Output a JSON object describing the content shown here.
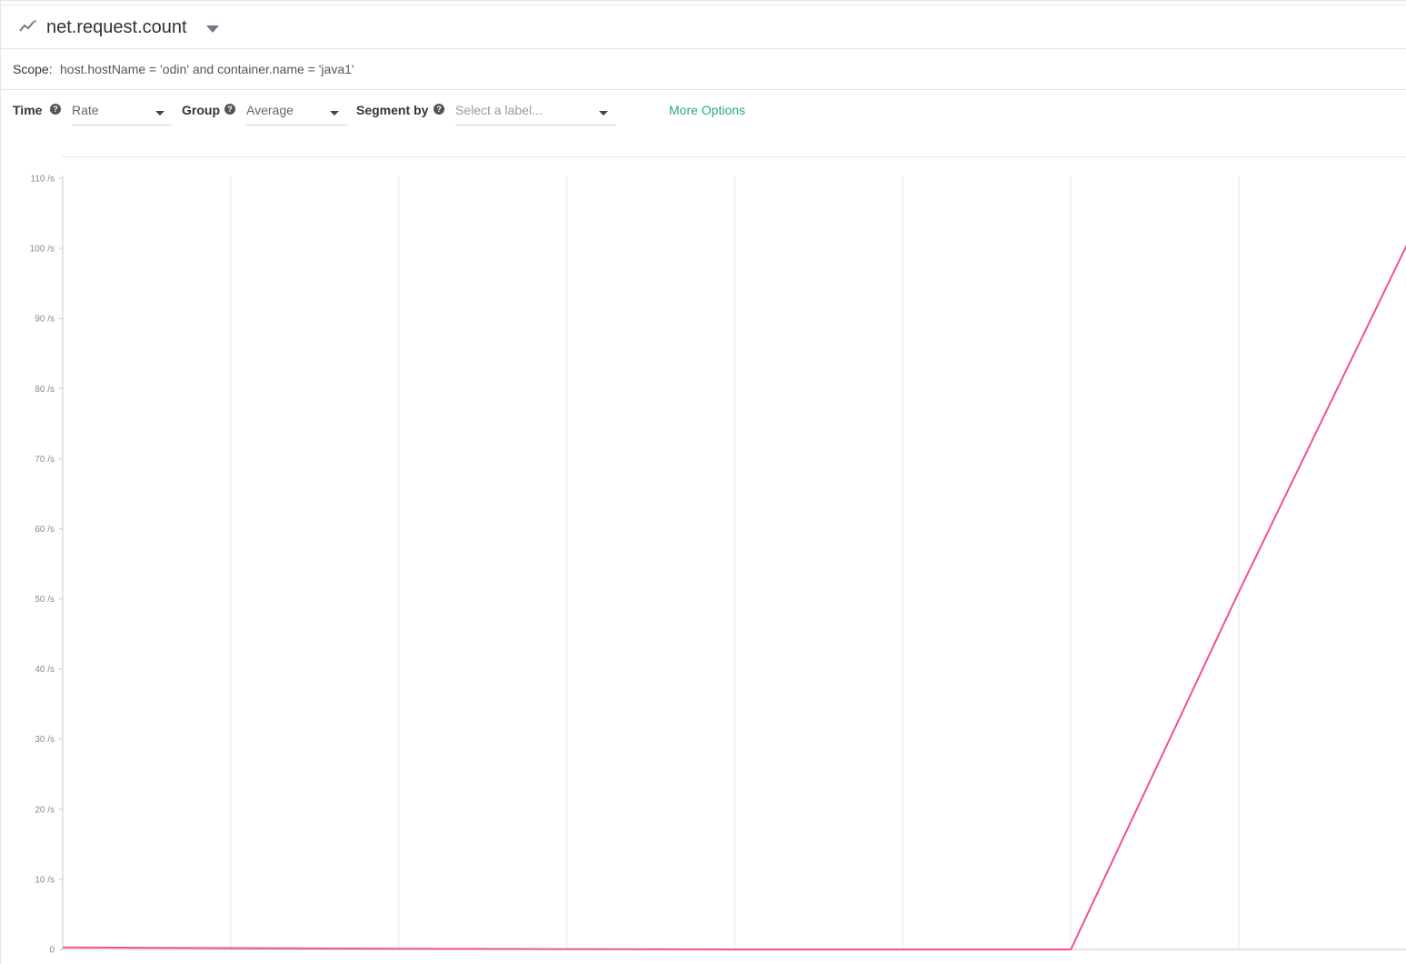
{
  "header": {
    "metric_name": "net.request.count"
  },
  "scope": {
    "label": "Scope:",
    "value": "host.hostName = 'odin' and container.name = 'java1'"
  },
  "controls": {
    "time_label": "Time",
    "time_value": "Rate",
    "group_label": "Group",
    "group_value": "Average",
    "segment_label": "Segment by",
    "segment_placeholder": "Select a label...",
    "more_options": "More Options"
  },
  "colors": {
    "accent": "#2aa886",
    "series": "#f0509a"
  },
  "chart_data": {
    "type": "line",
    "ylim": [
      0,
      110
    ],
    "yticks": [
      0,
      10,
      20,
      30,
      40,
      50,
      60,
      70,
      80,
      90,
      100,
      110
    ],
    "ytick_labels": [
      "0",
      "10 /s",
      "20 /s",
      "30 /s",
      "40 /s",
      "50 /s",
      "60 /s",
      "70 /s",
      "80 /s",
      "90 /s",
      "100 /s",
      "110 /s"
    ],
    "x_divisions": 8,
    "grid": "vertical",
    "series": [
      {
        "x": [
          0,
          1,
          2,
          3,
          4,
          5,
          6,
          7,
          8
        ],
        "values": [
          0.3,
          0.2,
          0.1,
          0.05,
          0,
          0,
          0,
          51,
          100.5
        ]
      }
    ]
  }
}
